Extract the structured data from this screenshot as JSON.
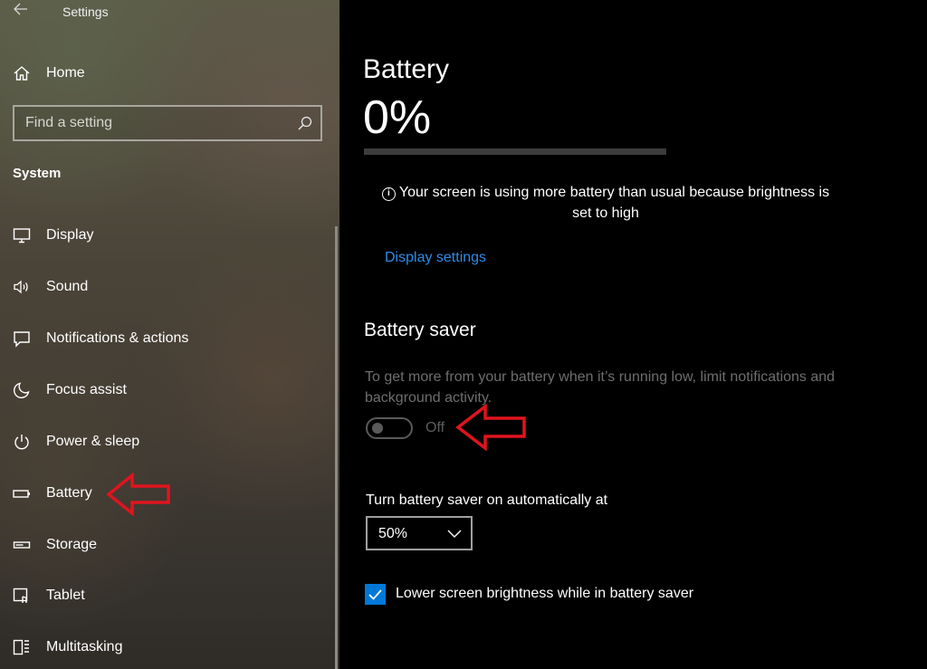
{
  "window": {
    "title": "Settings"
  },
  "sidebar": {
    "home_label": "Home",
    "search_placeholder": "Find a setting",
    "section_label": "System",
    "items": [
      {
        "label": "Display",
        "icon": "display-icon"
      },
      {
        "label": "Sound",
        "icon": "speaker-icon"
      },
      {
        "label": "Notifications & actions",
        "icon": "notification-icon"
      },
      {
        "label": "Focus assist",
        "icon": "moon-icon"
      },
      {
        "label": "Power & sleep",
        "icon": "power-icon"
      },
      {
        "label": "Battery",
        "icon": "battery-icon"
      },
      {
        "label": "Storage",
        "icon": "storage-icon"
      },
      {
        "label": "Tablet",
        "icon": "tablet-icon"
      },
      {
        "label": "Multitasking",
        "icon": "multitasking-icon"
      }
    ]
  },
  "main": {
    "title": "Battery",
    "percent_text": "0%",
    "percent_value": 0,
    "warning_text": "Your screen is using more battery than usual because brightness is set to high",
    "display_settings_link": "Display settings",
    "saver": {
      "title": "Battery saver",
      "description": "To get more from your battery when it’s running low, limit notifications and background activity.",
      "toggle_state": "Off",
      "toggle_on": false
    },
    "auto": {
      "label": "Turn battery saver on automatically at",
      "selected": "50%"
    },
    "brightness_checkbox": {
      "label": "Lower screen brightness while in battery saver",
      "checked": true
    }
  },
  "colors": {
    "accent": "#0078d7",
    "link": "#2b8ce8",
    "annotation_arrow": "#e0141e"
  }
}
